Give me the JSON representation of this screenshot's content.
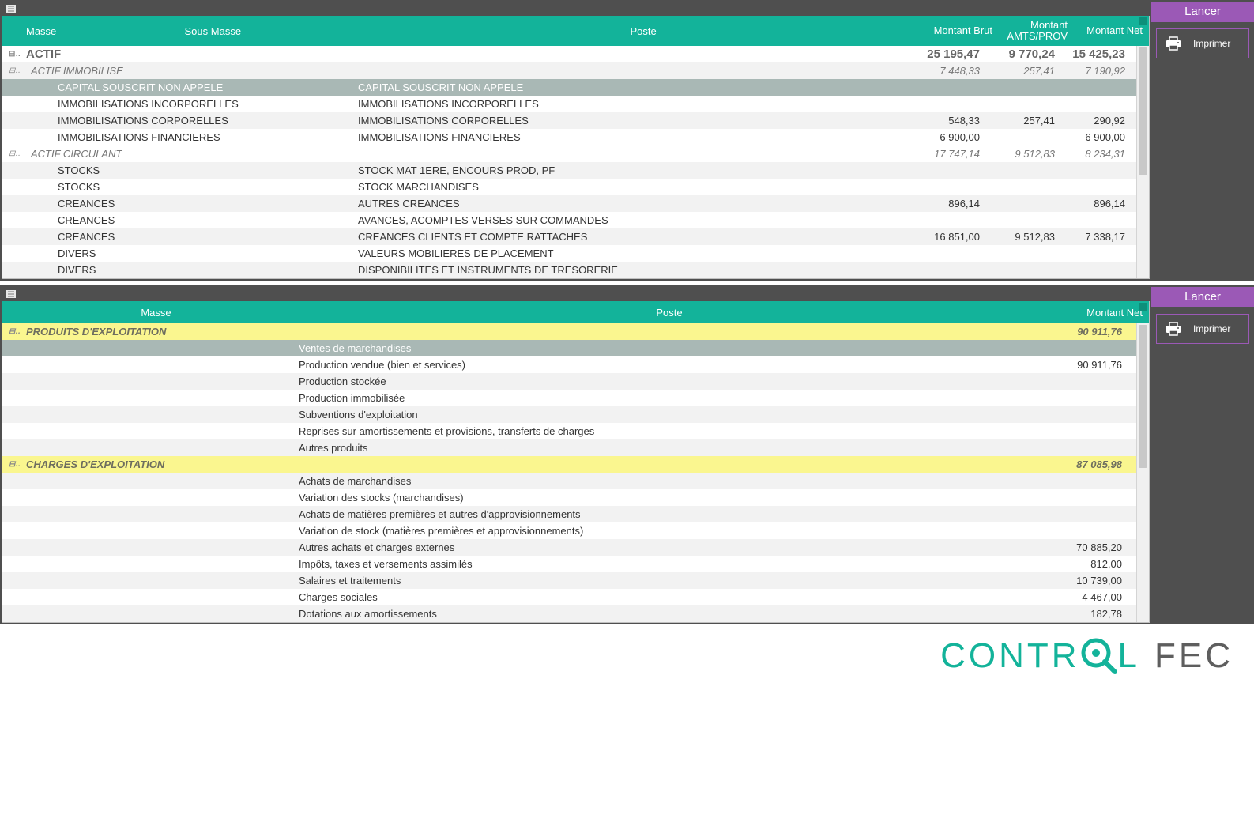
{
  "side": {
    "title": "Lancer",
    "print": "Imprimer"
  },
  "table1": {
    "headers": {
      "masse": "Masse",
      "sous": "Sous Masse",
      "poste": "Poste",
      "brut": "Montant Brut",
      "amts": "Montant AMTS/PROV",
      "net": "Montant Net"
    },
    "rows": [
      {
        "type": "cat",
        "toggle": "⊟",
        "label": "ACTIF",
        "brut": "25 195,47",
        "amts": "9 770,24",
        "net": "15 425,23"
      },
      {
        "type": "subcat",
        "toggle": "⊟",
        "label": "ACTIF IMMOBILISE",
        "brut": "7 448,33",
        "amts": "257,41",
        "net": "7 190,92"
      },
      {
        "type": "leaf-sel",
        "sous": "CAPITAL SOUSCRIT NON APPELE",
        "poste": "CAPITAL SOUSCRIT NON APPELE",
        "brut": "",
        "amts": "",
        "net": ""
      },
      {
        "type": "leaf",
        "sous": "IMMOBILISATIONS INCORPORELLES",
        "poste": "IMMOBILISATIONS INCORPORELLES",
        "brut": "",
        "amts": "",
        "net": ""
      },
      {
        "type": "leaf",
        "sous": "IMMOBILISATIONS CORPORELLES",
        "poste": "IMMOBILISATIONS CORPORELLES",
        "brut": "548,33",
        "amts": "257,41",
        "net": "290,92"
      },
      {
        "type": "leaf",
        "sous": "IMMOBILISATIONS FINANCIERES",
        "poste": "IMMOBILISATIONS FINANCIERES",
        "brut": "6 900,00",
        "amts": "",
        "net": "6 900,00"
      },
      {
        "type": "subcat",
        "toggle": "⊟",
        "label": "ACTIF CIRCULANT",
        "brut": "17 747,14",
        "amts": "9 512,83",
        "net": "8 234,31"
      },
      {
        "type": "leaf",
        "sous": "STOCKS",
        "poste": "STOCK MAT 1ERE, ENCOURS PROD, PF",
        "brut": "",
        "amts": "",
        "net": ""
      },
      {
        "type": "leaf",
        "sous": "STOCKS",
        "poste": "STOCK MARCHANDISES",
        "brut": "",
        "amts": "",
        "net": ""
      },
      {
        "type": "leaf",
        "sous": "CREANCES",
        "poste": "AUTRES CREANCES",
        "brut": "896,14",
        "amts": "",
        "net": "896,14"
      },
      {
        "type": "leaf",
        "sous": "CREANCES",
        "poste": "AVANCES, ACOMPTES VERSES SUR COMMANDES",
        "brut": "",
        "amts": "",
        "net": ""
      },
      {
        "type": "leaf",
        "sous": "CREANCES",
        "poste": "CREANCES CLIENTS ET COMPTE RATTACHES",
        "brut": "16 851,00",
        "amts": "9 512,83",
        "net": "7 338,17"
      },
      {
        "type": "leaf",
        "sous": "DIVERS",
        "poste": "VALEURS MOBILIERES DE PLACEMENT",
        "brut": "",
        "amts": "",
        "net": ""
      },
      {
        "type": "leaf",
        "sous": "DIVERS",
        "poste": "DISPONIBILITES ET INSTRUMENTS DE TRESORERIE",
        "brut": "",
        "amts": "",
        "net": ""
      }
    ]
  },
  "table2": {
    "headers": {
      "masse": "Masse",
      "poste": "Poste",
      "net": "Montant Net"
    },
    "rows": [
      {
        "type": "hl",
        "toggle": "⊟",
        "label": "PRODUITS D'EXPLOITATION",
        "net": "90 911,76"
      },
      {
        "type": "leaf-sel",
        "poste": "Ventes de marchandises",
        "net": ""
      },
      {
        "type": "leaf",
        "poste": "Production vendue (bien et services)",
        "net": "90 911,76"
      },
      {
        "type": "leaf",
        "poste": "Production stockée",
        "net": ""
      },
      {
        "type": "leaf",
        "poste": "Production immobilisée",
        "net": ""
      },
      {
        "type": "leaf",
        "poste": "Subventions d'exploitation",
        "net": ""
      },
      {
        "type": "leaf",
        "poste": "Reprises sur amortissements et provisions, transferts de charges",
        "net": ""
      },
      {
        "type": "leaf",
        "poste": "Autres produits",
        "net": ""
      },
      {
        "type": "hl",
        "toggle": "⊟",
        "label": "CHARGES D'EXPLOITATION",
        "net": "87 085,98"
      },
      {
        "type": "leaf",
        "poste": "Achats de marchandises",
        "net": ""
      },
      {
        "type": "leaf",
        "poste": "Variation des stocks (marchandises)",
        "net": ""
      },
      {
        "type": "leaf",
        "poste": "Achats de matières premières et autres d'approvisionnements",
        "net": ""
      },
      {
        "type": "leaf",
        "poste": "Variation de stock (matières premières et approvisionnements)",
        "net": ""
      },
      {
        "type": "leaf",
        "poste": "Autres achats et charges externes",
        "net": "70 885,20"
      },
      {
        "type": "leaf",
        "poste": "Impôts, taxes et versements assimilés",
        "net": "812,00"
      },
      {
        "type": "leaf",
        "poste": "Salaires et traitements",
        "net": "10 739,00"
      },
      {
        "type": "leaf",
        "poste": "Charges sociales",
        "net": "4 467,00"
      },
      {
        "type": "leaf",
        "poste": "Dotations aux amortissements",
        "net": "182,78"
      }
    ]
  },
  "logo": {
    "p1": "CONTR",
    "p2": "L",
    "p3": "FEC"
  }
}
